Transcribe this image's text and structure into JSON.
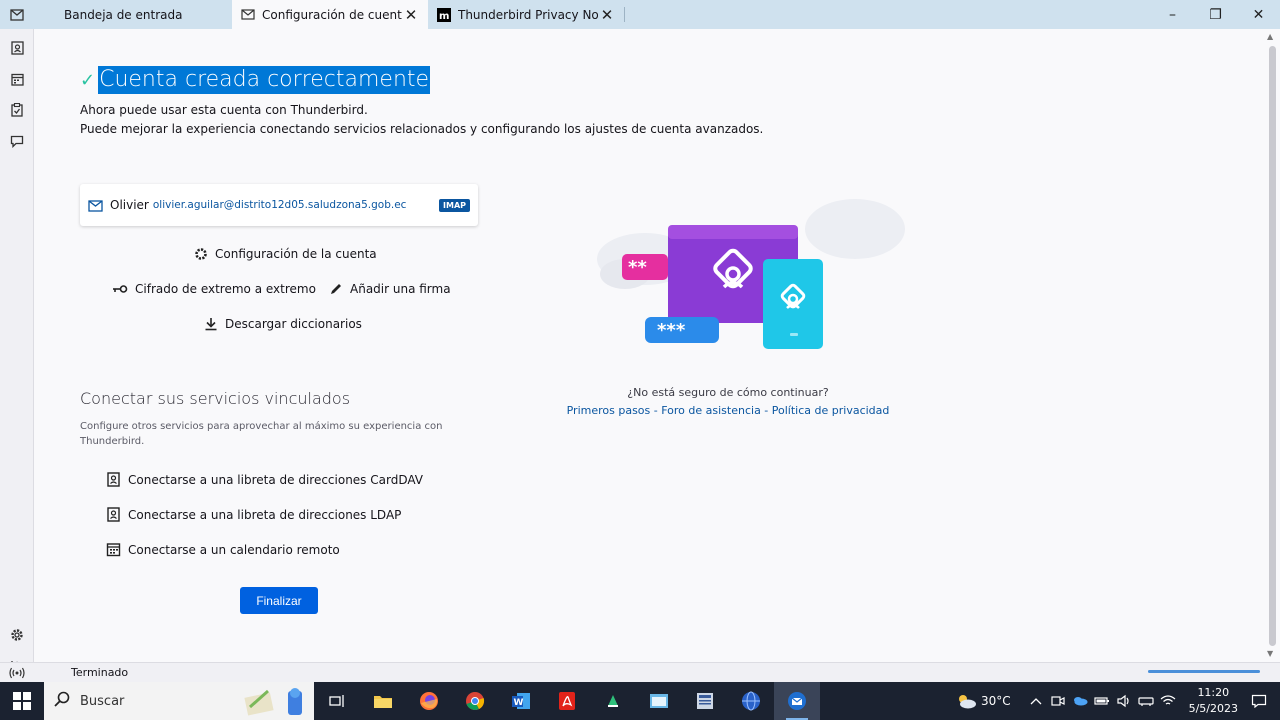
{
  "tabs": [
    {
      "label": "Bandeja de entrada",
      "icon": "inbox-icon"
    },
    {
      "label": "Configuración de cuenta",
      "icon": "mail-envelope-icon",
      "active": true
    },
    {
      "label": "Thunderbird Privacy Notice",
      "icon": "mozilla-icon"
    }
  ],
  "window_controls": {
    "minimize": "–",
    "restore": "❐",
    "close": "✕"
  },
  "spaces": [
    "mail-icon",
    "address-book-icon",
    "calendar-icon",
    "tasks-icon",
    "chat-icon",
    "settings-icon",
    "collapse-icon"
  ],
  "main": {
    "title": "Cuenta creada correctamente",
    "line1": "Ahora puede usar esta cuenta con Thunderbird.",
    "line2": "Puede mejorar la experiencia conectando servicios relacionados y configurando los ajustes de cuenta avanzados.",
    "account": {
      "name": "Olivier",
      "email": "olivier.aguilar@distrito12d05.saludzona5.gob.ec",
      "type": "IMAP"
    },
    "actions": {
      "settings": "Configuración de la cuenta",
      "e2e": "Cifrado de extremo a extremo",
      "signature": "Añadir una firma",
      "dictionaries": "Descargar diccionarios"
    },
    "linked": {
      "title": "Conectar sus servicios vinculados",
      "desc": "Configure otros servicios para aprovechar al máximo su experiencia con Thunderbird.",
      "carddav": "Conectarse a una libreta de direcciones CardDAV",
      "ldap": "Conectarse a una libreta de direcciones LDAP",
      "calendar": "Conectarse a un calendario remoto"
    },
    "finish_label": "Finalizar",
    "help": {
      "question": "¿No está seguro de cómo continuar?",
      "link1": "Primeros pasos",
      "link2": "Foro de asistencia",
      "link3": "Política de privacidad",
      "separator": " - "
    }
  },
  "statusbar": {
    "text": "Terminado",
    "progress": 1.0
  },
  "taskbar": {
    "search_label": "Buscar",
    "weather": "30°C",
    "time": "11:20",
    "date": "5/5/2023"
  }
}
